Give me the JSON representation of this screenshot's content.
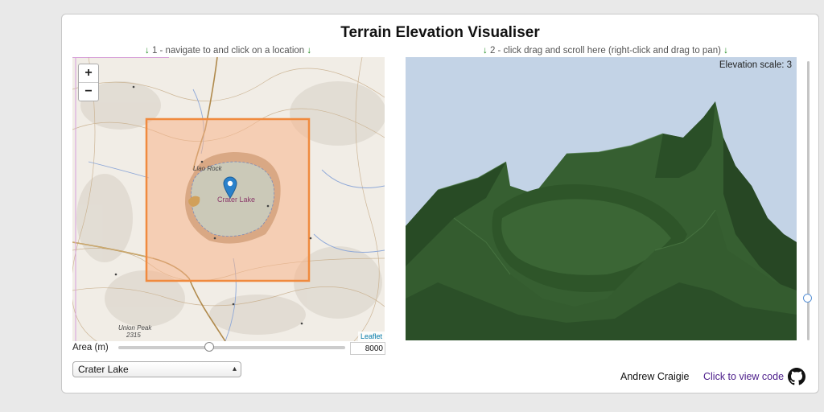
{
  "app": {
    "title": "Terrain Elevation Visualiser"
  },
  "hints": {
    "step1_arrow": "↓",
    "step1_text": " 1 - navigate to and click on a location ",
    "step2_arrow": "↓",
    "step2_text": " 2 - click drag and scroll here (right-click and drag to pan) "
  },
  "map": {
    "zoom_in": "+",
    "zoom_out": "−",
    "attribution": "Leaflet",
    "poi_label": "Crater Lake",
    "labels": {
      "llao_rock": "Llao Rock",
      "union_peak": "Union Peak",
      "union_peak_elev": "2315"
    },
    "icons": {
      "marker": "map-marker-icon"
    }
  },
  "area": {
    "label": "Area (m)",
    "value": "8000",
    "slider_fraction": 0.4
  },
  "location_select": {
    "selected": "Crater Lake"
  },
  "viewer": {
    "elevation_scale_text": "Elevation scale: 3",
    "scale_slider_fraction": 0.15,
    "terrain_color": "#2f5a2c",
    "sky_color": "#c3d3e6"
  },
  "footer": {
    "author": "Andrew Craigie",
    "code_link": "Click to view code",
    "github_icon": "github-icon"
  },
  "colors": {
    "selection_fill": "#f7b48a",
    "selection_border": "#f08a3e",
    "arrow": "#1e8a1e"
  }
}
